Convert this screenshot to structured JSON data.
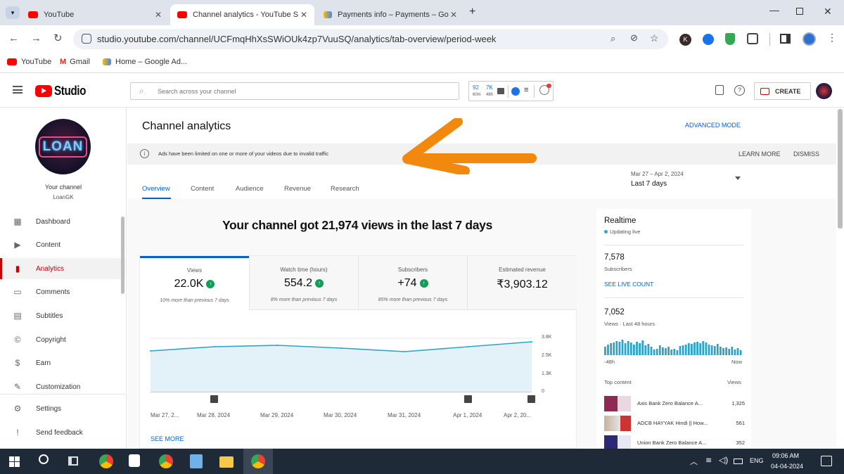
{
  "browser": {
    "tabs": [
      {
        "label": "YouTube",
        "active": false
      },
      {
        "label": "Channel analytics - YouTube Stu",
        "active": true
      },
      {
        "label": "Payments info – Payments – Go",
        "active": false
      }
    ],
    "url": "studio.youtube.com/channel/UCFmqHhXsSWiOUk4zp7VuuSQ/analytics/tab-overview/period-week",
    "bookmarks": [
      "YouTube",
      "Gmail",
      "Home – Google Ad..."
    ],
    "ext_counter": {
      "a": "92",
      "a_sub": "60m",
      "b": "7K",
      "b_sub": "48h"
    },
    "profile_letter": "K"
  },
  "studio": {
    "logo_text": "Studio",
    "search_placeholder": "Search across your channel",
    "create_label": "CREATE"
  },
  "sidebar": {
    "channel_avatar_text": "LOAN",
    "your_channel": "Your channel",
    "channel_name": "LoanGK",
    "items": [
      {
        "label": "Dashboard",
        "icon": "dashboard-icon"
      },
      {
        "label": "Content",
        "icon": "content-icon"
      },
      {
        "label": "Analytics",
        "icon": "analytics-icon",
        "active": true
      },
      {
        "label": "Comments",
        "icon": "comments-icon"
      },
      {
        "label": "Subtitles",
        "icon": "subtitles-icon"
      },
      {
        "label": "Copyright",
        "icon": "copyright-icon"
      },
      {
        "label": "Earn",
        "icon": "earn-icon"
      },
      {
        "label": "Customization",
        "icon": "customization-icon"
      },
      {
        "label": "Settings",
        "icon": "settings-icon"
      },
      {
        "label": "Send feedback",
        "icon": "feedback-icon"
      }
    ]
  },
  "analytics": {
    "title": "Channel analytics",
    "advanced_mode": "ADVANCED MODE",
    "banner_text": "Ads have been limited on one or more of your videos due to invalid traffic",
    "learn_more": "LEARN MORE",
    "dismiss": "DISMISS",
    "tabs": [
      "Overview",
      "Content",
      "Audience",
      "Revenue",
      "Research"
    ],
    "period_range": "Mar 27 – Apr 2, 2024",
    "period_label": "Last 7 days",
    "headline": "Your channel got 21,974 views in the last 7 days",
    "metrics": [
      {
        "title": "Views",
        "value": "22.0K",
        "sub": "10% more than previous 7 days",
        "up": true
      },
      {
        "title": "Watch time (hours)",
        "value": "554.2",
        "sub": "8% more than previous 7 days",
        "up": true
      },
      {
        "title": "Subscribers",
        "value": "+74",
        "sub": "85% more than previous 7 days",
        "up": true
      },
      {
        "title": "Estimated revenue",
        "value": "₹3,903.12",
        "sub": "",
        "up": false
      }
    ],
    "see_more": "SEE MORE"
  },
  "chart_data": {
    "type": "area",
    "x": [
      "Mar 27, 2...",
      "Mar 28, 2024",
      "Mar 29, 2024",
      "Mar 30, 2024",
      "Mar 31, 2024",
      "Apr 1, 2024",
      "Apr 2, 20..."
    ],
    "series": [
      {
        "values": [
          2.9,
          3.2,
          3.3,
          3.1,
          2.85,
          3.2,
          3.55
        ]
      }
    ],
    "yticks": [
      "3.8K",
      "2.5K",
      "1.3K",
      "0"
    ],
    "ylim": [
      0,
      3.8
    ],
    "color": "#2ea3c9"
  },
  "realtime": {
    "title": "Realtime",
    "status": "Updating live",
    "subs_value": "7,578",
    "subs_label": "Subscribers",
    "see_live": "SEE LIVE COUNT",
    "views_value": "7,052",
    "views_label": "Views · Last 48 hours",
    "axis_start": "-48h",
    "axis_end": "Now",
    "top_content_label": "Top content",
    "views_col": "Views",
    "top_content": [
      {
        "title": "Axis Bank Zero Balance A...",
        "views": "1,325"
      },
      {
        "title": "ADCB HAYYAK Hindi || How...",
        "views": "561"
      },
      {
        "title": "Union Bank Zero Balance A...",
        "views": "352"
      }
    ]
  },
  "taskbar": {
    "lang": "ENG",
    "time": "09:06 AM",
    "date": "04-04-2024"
  },
  "colors": {
    "accent_blue": "#065fd4",
    "yt_red": "#ff0000",
    "arrow_orange": "#f2890f"
  }
}
